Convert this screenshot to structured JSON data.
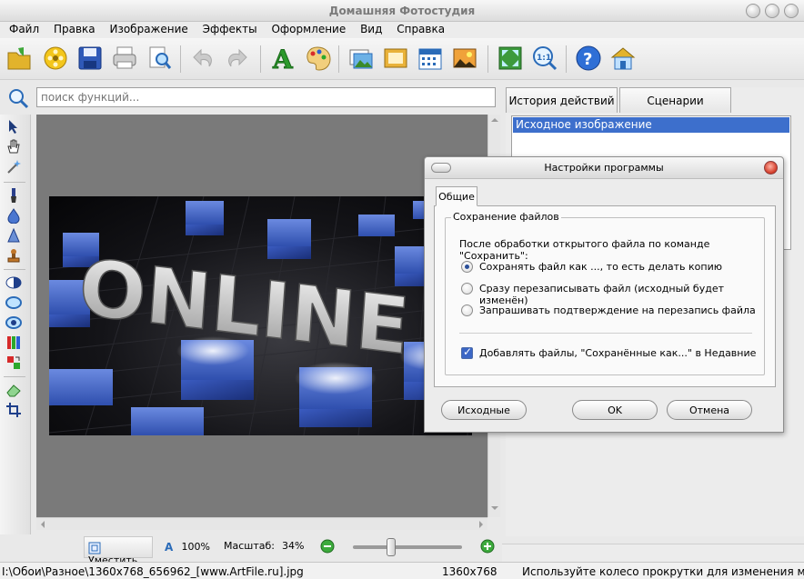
{
  "window": {
    "title": "Домашняя Фотостудия"
  },
  "menu": [
    "Файл",
    "Правка",
    "Изображение",
    "Эффекты",
    "Оформление",
    "Вид",
    "Справка"
  ],
  "search": {
    "placeholder": "поиск функций..."
  },
  "history_panel": {
    "tabs": [
      "История действий",
      "Сценарии"
    ],
    "items": [
      "Исходное изображение"
    ]
  },
  "image_text": "ONLINE",
  "zoom": {
    "fit_label": "Уместить",
    "percent_label": "100%",
    "scale_label": "Масштаб:",
    "scale_value": "34%",
    "slider_value": 0.34
  },
  "status": {
    "path": "I:\\Обои\\Разное\\1360x768_656962_[www.ArtFile.ru].jpg",
    "dimensions": "1360x768",
    "hint": "Используйте колесо прокрутки для изменения масш"
  },
  "dialog": {
    "title": "Настройки программы",
    "tab": "Общие",
    "group_title": "Сохранение файлов",
    "question": "После обработки открытого файла по команде \"Сохранить\":",
    "options": [
      "Сохранять файл как ..., то есть делать копию",
      "Сразу перезаписывать файл (исходный будет изменён)",
      "Запрашивать подтверждение на перезапись файла"
    ],
    "selected_option": 0,
    "checkbox_label": "Добавлять файлы, \"Сохранённые как...\" в Недавние",
    "checkbox_checked": true,
    "buttons": {
      "defaults": "Исходные",
      "ok": "OK",
      "cancel": "Отмена"
    }
  },
  "colors": {
    "selection": "#3d6fcc",
    "canvas": "#7a7a7a",
    "accent_blue": "#3a5fb8"
  }
}
